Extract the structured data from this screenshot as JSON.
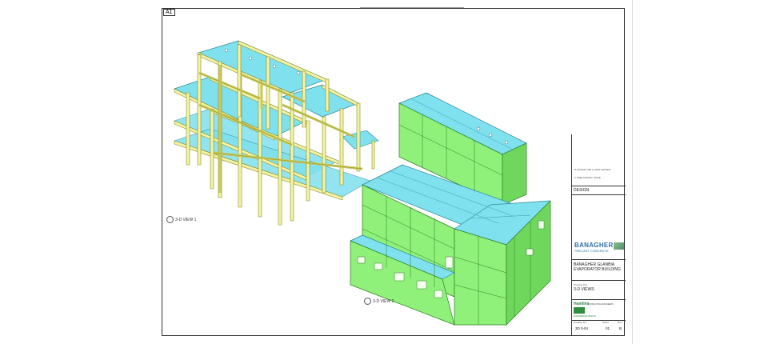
{
  "sheet": {
    "size_label": "A1"
  },
  "views": [
    {
      "label": "3-D VIEW 1"
    },
    {
      "label": "3-D VIEW 2"
    }
  ],
  "colors": {
    "frame_fill": "#f3f3a6",
    "frame_stroke": "#8a8a20",
    "slab_fill": "#7fe0ee",
    "slab_stroke": "#2b8a99",
    "wall_fill": "#8ff07a",
    "wall_stroke": "#2e7f22"
  },
  "title_block": {
    "revisions": [
      {
        "rev": "B",
        "note": "ISSUED FOR CLIENT REVIEW"
      },
      {
        "rev": "A",
        "note": "PRELIMINARY ISSUE"
      }
    ],
    "status": "DESIGN",
    "company": {
      "name": "BANAGHER",
      "subtitle": "PRECAST CONCRETE"
    },
    "project_name": "BANAGHER GLANBIA EVAPORATOR BUILDING",
    "drawing_title_label": "Drawing Title",
    "drawing_title": "3-D VIEWS",
    "consultant": {
      "name": "Hamlins",
      "subtitle": "ENGINEERING DESIGN",
      "address": "CONSULTING ENGINEERS"
    },
    "drawing_no_label": "Drawing No.",
    "drawing_no": "3D 0-04",
    "sheet_label": "Sheet",
    "sheet_no": "01",
    "rev_label": "Rev",
    "rev_no": "B"
  }
}
